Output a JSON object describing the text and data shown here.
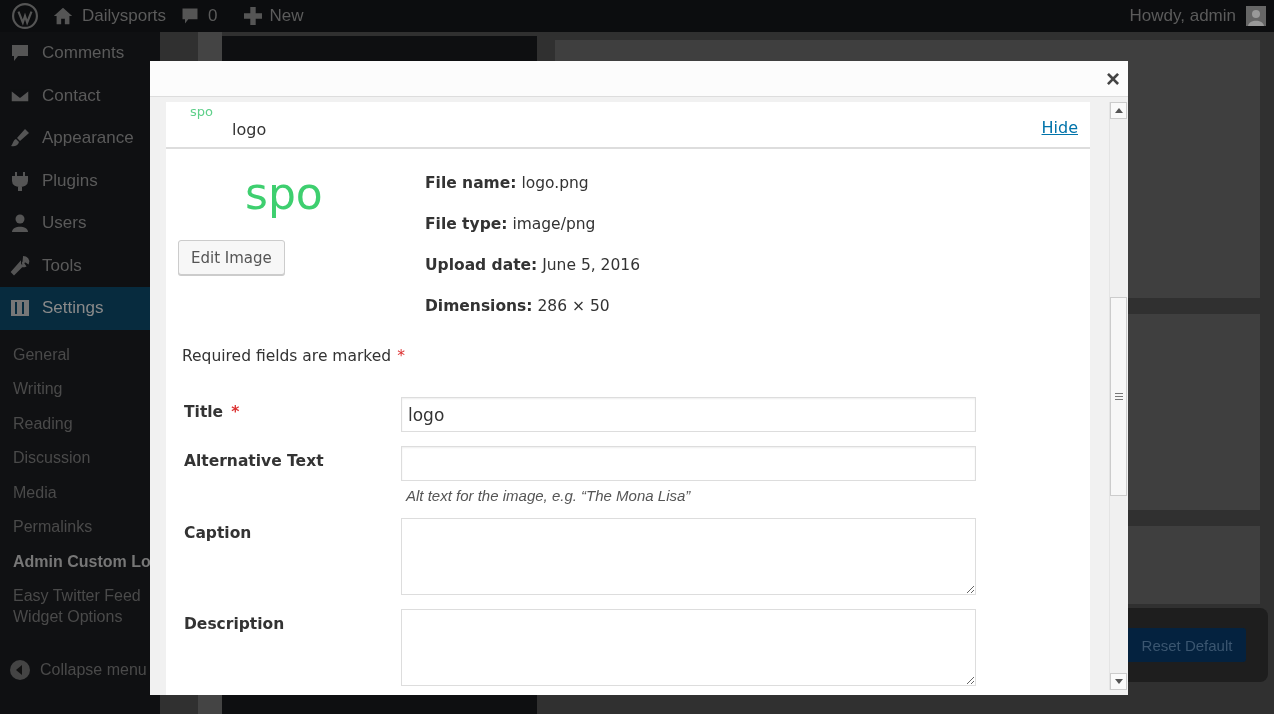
{
  "admin_bar": {
    "site": "Dailysports",
    "comments_count": "0",
    "new": "New",
    "greeting": "Howdy, admin"
  },
  "sidebar": {
    "items": [
      {
        "label": "Comments",
        "selected": false
      },
      {
        "label": "Contact",
        "selected": false
      },
      {
        "label": "Appearance",
        "selected": false
      },
      {
        "label": "Plugins",
        "selected": false
      },
      {
        "label": "Users",
        "selected": false
      },
      {
        "label": "Tools",
        "selected": false
      },
      {
        "label": "Settings",
        "selected": true
      }
    ],
    "submenu": [
      {
        "label": "General",
        "selected": false
      },
      {
        "label": "Writing",
        "selected": false
      },
      {
        "label": "Reading",
        "selected": false
      },
      {
        "label": "Discussion",
        "selected": false
      },
      {
        "label": "Media",
        "selected": false
      },
      {
        "label": "Permalinks",
        "selected": false
      },
      {
        "label": "Admin Custom Lo",
        "selected": true
      },
      {
        "label": "Easy Twitter Feed Widget Options",
        "selected": false
      }
    ],
    "collapse": "Collapse menu"
  },
  "background": {
    "reset_button": "Reset Default"
  },
  "modal": {
    "close": "×",
    "attachment": {
      "title": "logo",
      "thumb_text": "spo",
      "hide_link": "Hide",
      "preview_text": "spo",
      "edit_button": "Edit Image",
      "details": [
        {
          "label": "File name:",
          "value": "logo.png"
        },
        {
          "label": "File type:",
          "value": "image/png"
        },
        {
          "label": "Upload date:",
          "value": "June 5, 2016"
        },
        {
          "label": "Dimensions:",
          "value": "286 × 50"
        }
      ]
    },
    "required_note": "Required fields are marked",
    "required_mark": "*",
    "fields": [
      {
        "label": "Title",
        "required": true,
        "kind": "input",
        "value": "logo"
      },
      {
        "label": "Alternative Text",
        "required": false,
        "kind": "input",
        "help": "Alt text for the image, e.g. “The Mona Lisa”"
      },
      {
        "label": "Caption",
        "required": false,
        "kind": "textarea"
      },
      {
        "label": "Description",
        "required": false,
        "kind": "textarea"
      }
    ]
  }
}
